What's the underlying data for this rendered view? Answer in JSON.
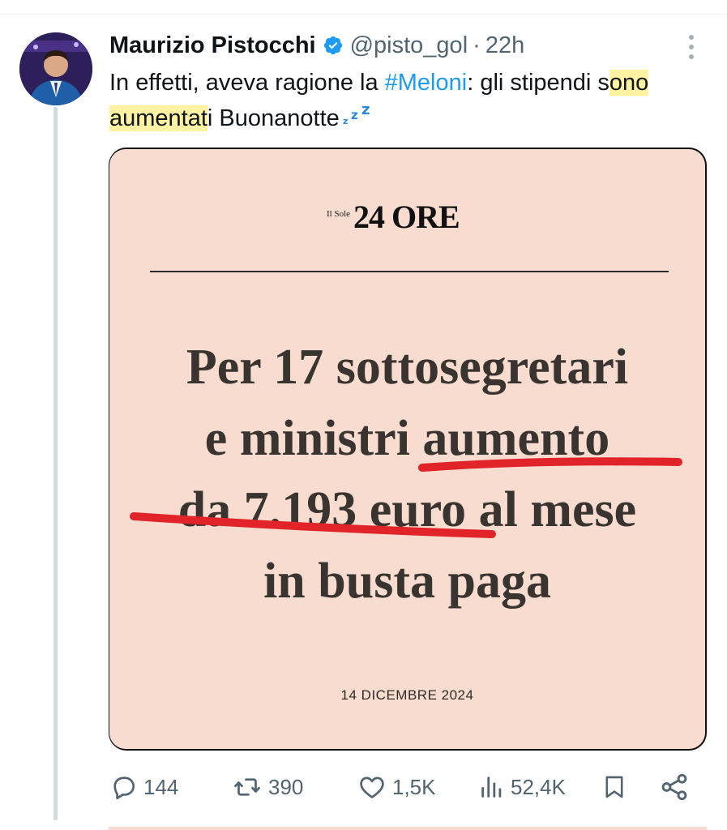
{
  "tweet": {
    "author": {
      "display_name": "Maurizio Pistocchi",
      "handle": "@pisto_gol",
      "separator": "·",
      "time": "22h",
      "verified": true
    },
    "text": {
      "part1": "In effetti, aveva ragione la ",
      "hashtag": "#Meloni",
      "part2": ": gli stipendi s",
      "highlighted": "ono aumentat",
      "part3": "i Buonanotte",
      "emoji": "zzz-icon"
    },
    "media": {
      "masthead_small": "Il Sole",
      "masthead_big": "24 ORE",
      "headline_lines": [
        "Per 17 sottosegretari",
        "e ministri aumento",
        "da 7.193 euro al mese",
        "in busta paga"
      ],
      "date": "14 DICEMBRE 2024"
    },
    "actions": {
      "replies": "144",
      "retweets": "390",
      "likes": "1,5K",
      "views": "52,4K"
    }
  },
  "colors": {
    "text": "#0f1419",
    "secondary": "#536471",
    "link": "#1d9bf0",
    "highlight": "#fff3a3",
    "paper": "#f7dccf",
    "underline": "#e0242a"
  },
  "icons": [
    "verified-badge-icon",
    "more-options-icon",
    "reply-icon",
    "retweet-icon",
    "like-icon",
    "views-icon",
    "bookmark-icon",
    "share-icon"
  ]
}
